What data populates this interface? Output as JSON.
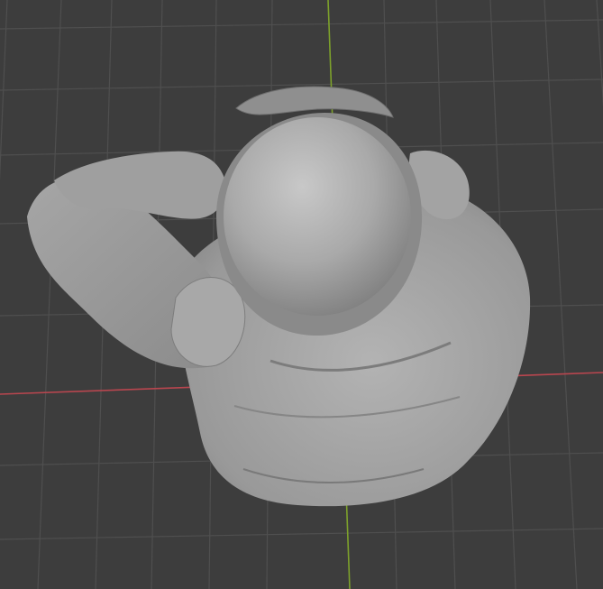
{
  "viewport": {
    "background": "#3d3d3d",
    "grid_line_color": "#4f4f4f",
    "x_axis_color": "#b9464f",
    "y_axis_color": "#7da12b",
    "model_base_color": "#9c9c9c",
    "model_highlight_color": "#c4c4c4",
    "model_shadow_color": "#6f6f6f"
  }
}
